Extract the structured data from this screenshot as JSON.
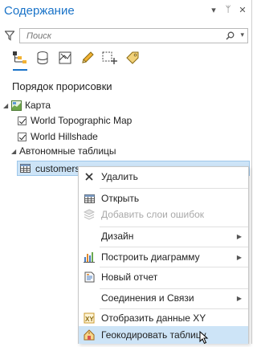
{
  "panel": {
    "title": "Содержание",
    "title_icons": [
      "▾",
      "ᛘ",
      "✕"
    ]
  },
  "search": {
    "placeholder": "Поиск"
  },
  "section_title": "Порядок прорисовки",
  "tree": {
    "map": "Карта",
    "layers": [
      {
        "label": "World Topographic Map",
        "checked": true
      },
      {
        "label": "World Hillshade",
        "checked": true
      }
    ],
    "standalone": "Автономные таблицы",
    "table": "customers"
  },
  "context_menu": {
    "items": [
      {
        "label": "Удалить",
        "icon": "delete-icon",
        "disabled": false,
        "submenu": false
      },
      {
        "label": "Открыть",
        "icon": "table-icon",
        "disabled": false,
        "submenu": false
      },
      {
        "label": "Добавить слои ошибок",
        "icon": "error-layers-icon",
        "disabled": true,
        "submenu": false
      },
      {
        "label": "Дизайн",
        "icon": "",
        "disabled": false,
        "submenu": true
      },
      {
        "label": "Построить диаграмму",
        "icon": "chart-icon",
        "disabled": false,
        "submenu": true
      },
      {
        "label": "Новый отчет",
        "icon": "report-icon",
        "disabled": false,
        "submenu": false
      },
      {
        "label": "Соединения и Связи",
        "icon": "",
        "disabled": false,
        "submenu": true
      },
      {
        "label": "Отобразить данные XY",
        "icon": "xy-icon",
        "disabled": false,
        "submenu": false
      },
      {
        "label": "Геокодировать таблицу",
        "icon": "geocode-icon",
        "disabled": false,
        "submenu": false,
        "hover": true
      }
    ]
  },
  "colors": {
    "accent": "#1a73c8",
    "selection": "#cde4f7"
  }
}
